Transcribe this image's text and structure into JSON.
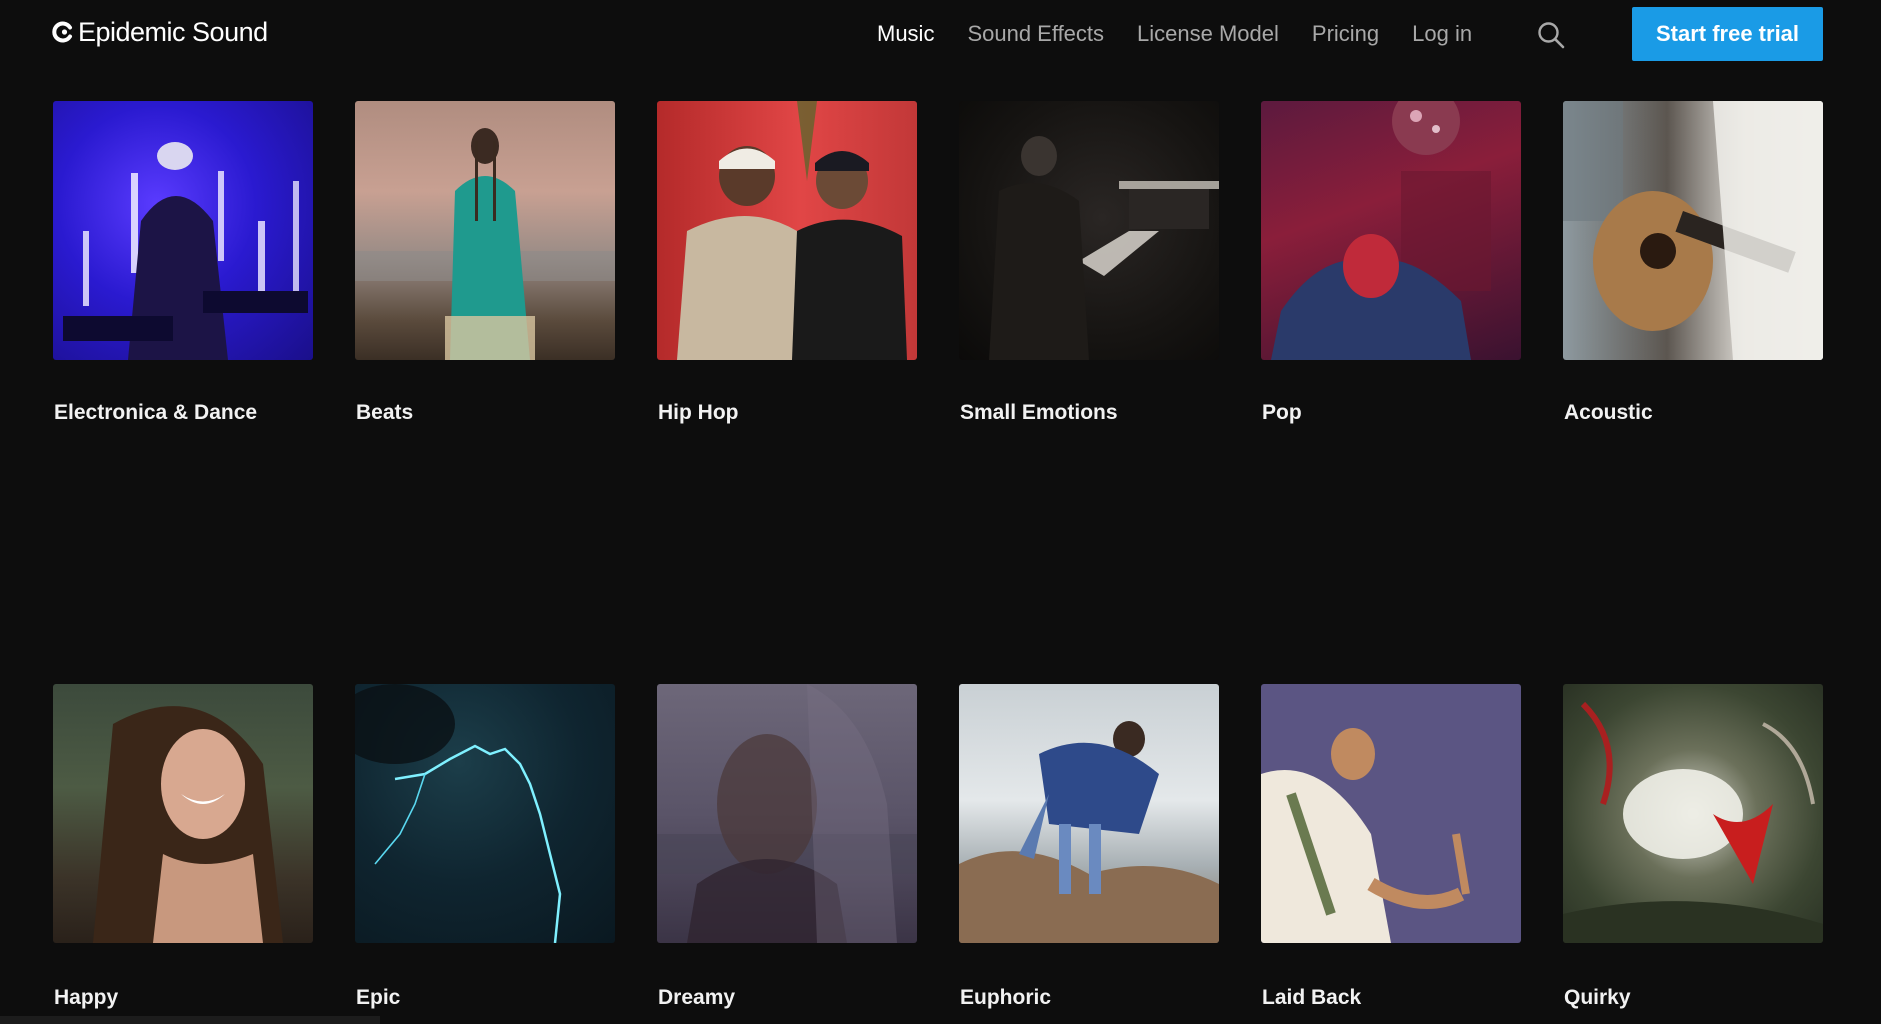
{
  "brand": {
    "name": "Epidemic Sound"
  },
  "nav": {
    "items": [
      {
        "label": "Music",
        "active": true
      },
      {
        "label": "Sound Effects",
        "active": false
      },
      {
        "label": "License Model",
        "active": false
      },
      {
        "label": "Pricing",
        "active": false
      },
      {
        "label": "Log in",
        "active": false
      }
    ],
    "search_icon": "search-icon",
    "cta_label": "Start free trial"
  },
  "colors": {
    "background": "#0d0d0d",
    "accent": "#1a9be6",
    "nav_inactive": "#a8a8a8",
    "text": "#ffffff"
  },
  "genres": {
    "row1": [
      {
        "label": "Electronica & Dance"
      },
      {
        "label": "Beats"
      },
      {
        "label": "Hip Hop"
      },
      {
        "label": "Small Emotions"
      },
      {
        "label": "Pop"
      },
      {
        "label": "Acoustic"
      }
    ],
    "row2": [
      {
        "label": "Happy"
      },
      {
        "label": "Epic"
      },
      {
        "label": "Dreamy"
      },
      {
        "label": "Euphoric"
      },
      {
        "label": "Laid Back"
      },
      {
        "label": "Quirky"
      }
    ]
  }
}
